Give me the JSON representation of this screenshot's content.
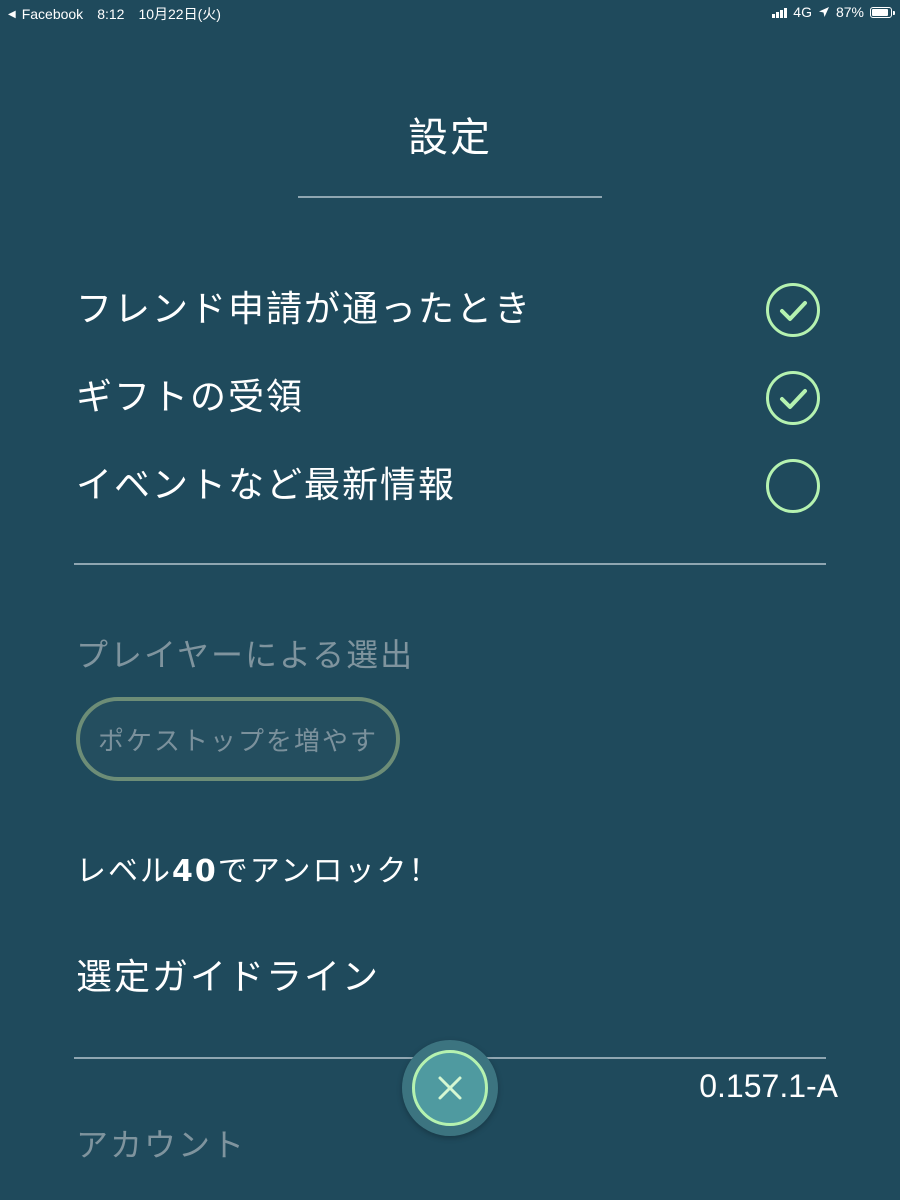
{
  "status_bar": {
    "back_app": "Facebook",
    "time": "8:12",
    "date": "10月22日(火)",
    "network": "4G",
    "battery_percent": "87%",
    "battery_level": 0.87
  },
  "header": {
    "title": "設定"
  },
  "notifications": [
    {
      "label": "フレンド申請が通ったとき",
      "checked": true
    },
    {
      "label": "ギフトの受領",
      "checked": true
    },
    {
      "label": "イベントなど最新情報",
      "checked": false
    }
  ],
  "player_selection": {
    "heading": "プレイヤーによる選出",
    "button_label": "ポケストップを増やす",
    "unlock_prefix": "レベル",
    "unlock_level": "40",
    "unlock_suffix": "でアンロック！"
  },
  "guideline_link": "選定ガイドライン",
  "version": "0.157.1-A",
  "account_heading": "アカウント",
  "colors": {
    "background": "#1f4a5c",
    "accent_green": "#b5f2b0",
    "muted_text": "#7f949e"
  },
  "icons": {
    "check": "checkmark-circle-icon",
    "close": "close-x-icon"
  }
}
